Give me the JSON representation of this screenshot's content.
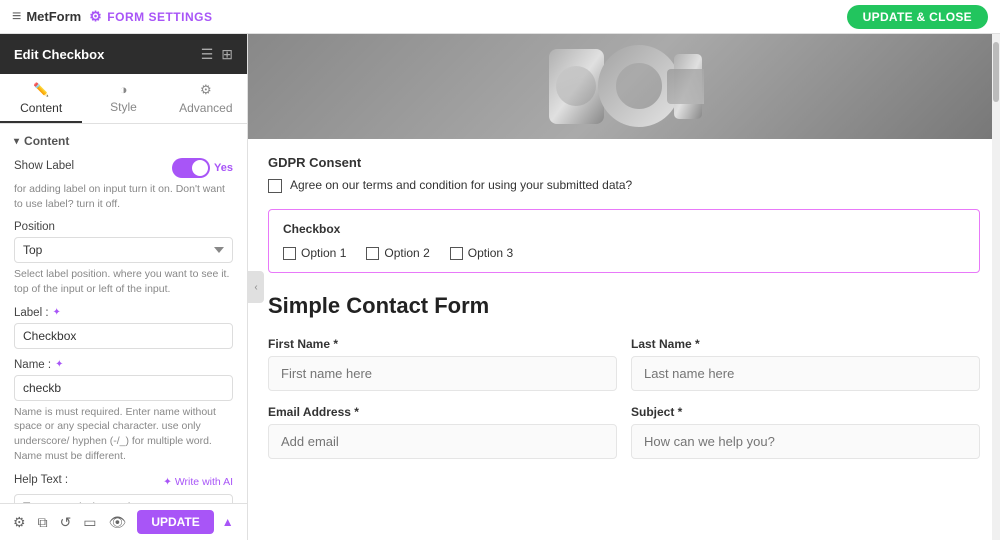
{
  "topbar": {
    "logo": "MetForm",
    "logo_icon": "≡",
    "form_settings_label": "FORM SETTINGS",
    "update_close_label": "UPDATE & CLOSE"
  },
  "sidebar": {
    "header_title": "Edit Checkbox",
    "tabs": [
      {
        "id": "content",
        "label": "Content",
        "icon": "✏️",
        "active": true
      },
      {
        "id": "style",
        "label": "Style",
        "icon": "◑"
      },
      {
        "id": "advanced",
        "label": "Advanced",
        "icon": "⚙"
      }
    ],
    "section_title": "Content",
    "show_label": {
      "label": "Show Label",
      "toggle_value": "Yes",
      "hint": "for adding label on input turn it on. Don't want to use label? turn it off."
    },
    "position": {
      "label": "Position",
      "value": "Top",
      "hint": "Select label position. where you want to see it. top of the input or left of the input."
    },
    "label_field": {
      "label": "Label :",
      "value": "Checkbox"
    },
    "name_field": {
      "label": "Name :",
      "value": "checkb",
      "hint": "Name is must required. Enter name without space or any special character. use only underscore/ hyphen (-/_) for multiple word. Name must be different."
    },
    "help_text": {
      "label": "Help Text :",
      "write_ai_label": "✦ Write with AI",
      "placeholder": "Type your help text here"
    },
    "bottom": {
      "update_label": "UPDATE"
    }
  },
  "preview": {
    "gdpr": {
      "title": "GDPR Consent",
      "text": "Agree on our terms and condition for using your submitted data?"
    },
    "checkbox_section": {
      "title": "Checkbox",
      "options": [
        "Option 1",
        "Option 2",
        "Option 3"
      ]
    },
    "form_title": "Simple Contact Form",
    "fields": [
      {
        "label": "First Name *",
        "placeholder": "First name here"
      },
      {
        "label": "Last Name *",
        "placeholder": "Last name here"
      },
      {
        "label": "Email Address *",
        "placeholder": "Add email"
      },
      {
        "label": "Subject *",
        "placeholder": "How can we help you?"
      }
    ]
  }
}
